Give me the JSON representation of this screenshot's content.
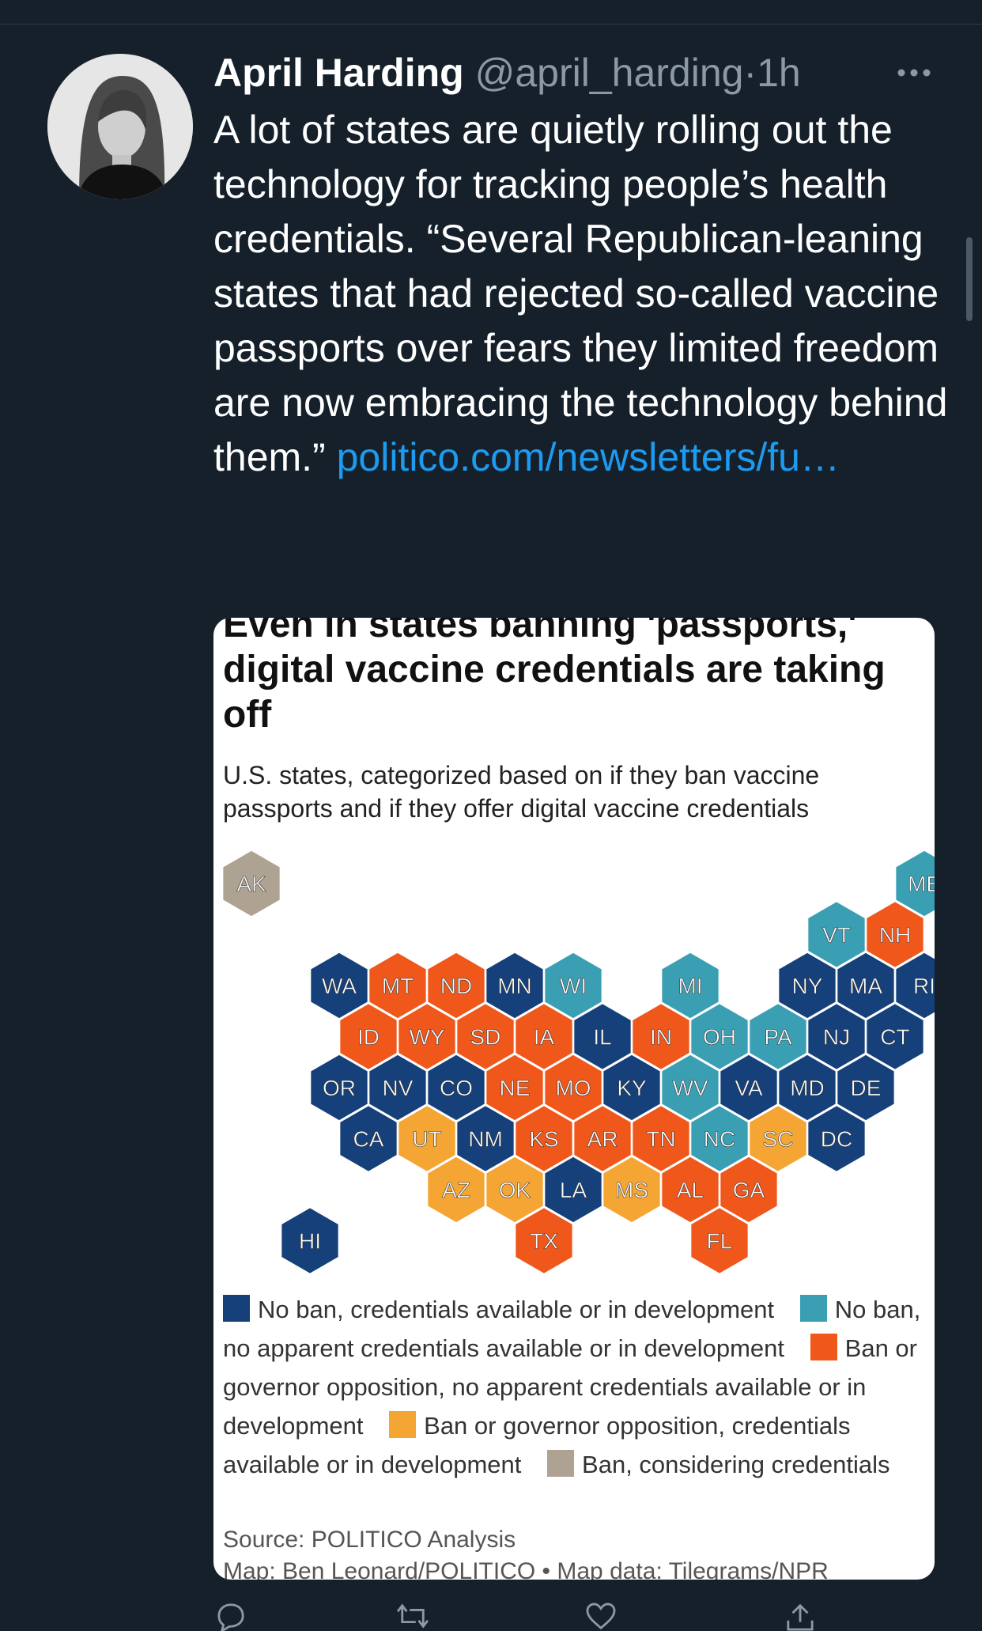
{
  "tweet": {
    "author_name": "April Harding",
    "handle": "@april_harding",
    "separator": "·",
    "time": "1h",
    "text": "A lot of states are quietly rolling out the technology for tracking people’s health credentials. “Several Republican-leaning states that had rejected so-called vaccine passports over fears they limited freedom are now embracing the technology behind them.” ",
    "link_text": "politico.com/newsletters/fu…"
  },
  "card": {
    "title": "Even in states banning 'passports,' digital vaccine credentials are taking off",
    "subtitle": "U.S. states, categorized based on if they ban vaccine passports and if they offer digital vaccine credentials",
    "source": "Source: POLITICO Analysis",
    "credit": "Map: Ben Leonard/POLITICO • Map data: Tilegrams/NPR"
  },
  "colors": {
    "background": "#15202b",
    "accent": "#1d9bf0",
    "no_ban_credentials": "#15407a",
    "no_ban_no_credentials": "#3b9fb4",
    "ban_no_credentials": "#f0571b",
    "ban_credentials": "#f5a533",
    "ban_considering": "#aea293"
  },
  "legend": [
    {
      "key": "no_ban_credentials",
      "label": "No ban, credentials available or in development"
    },
    {
      "key": "no_ban_no_credentials",
      "label": "No ban, no apparent credentials available or in development"
    },
    {
      "key": "ban_no_credentials",
      "label": "Ban or governor opposition, no apparent credentials available or in development"
    },
    {
      "key": "ban_credentials",
      "label": "Ban or governor opposition, credentials available or in development"
    },
    {
      "key": "ban_considering",
      "label": "Ban, considering credentials"
    }
  ],
  "map_states": [
    {
      "abbr": "AK",
      "category": "ban_considering",
      "row": 0,
      "col": 0
    },
    {
      "abbr": "ME",
      "category": "no_ban_no_credentials",
      "row": 0,
      "col": 11.5
    },
    {
      "abbr": "VT",
      "category": "no_ban_no_credentials",
      "row": 1,
      "col": 10
    },
    {
      "abbr": "NH",
      "category": "ban_no_credentials",
      "row": 1,
      "col": 11
    },
    {
      "abbr": "WA",
      "category": "no_ban_credentials",
      "row": 2,
      "col": 1.5
    },
    {
      "abbr": "MT",
      "category": "ban_no_credentials",
      "row": 2,
      "col": 2.5
    },
    {
      "abbr": "ND",
      "category": "ban_no_credentials",
      "row": 2,
      "col": 3.5
    },
    {
      "abbr": "MN",
      "category": "no_ban_credentials",
      "row": 2,
      "col": 4.5
    },
    {
      "abbr": "WI",
      "category": "no_ban_no_credentials",
      "row": 2,
      "col": 5.5
    },
    {
      "abbr": "MI",
      "category": "no_ban_no_credentials",
      "row": 2,
      "col": 7.5
    },
    {
      "abbr": "NY",
      "category": "no_ban_credentials",
      "row": 2,
      "col": 9.5
    },
    {
      "abbr": "MA",
      "category": "no_ban_credentials",
      "row": 2,
      "col": 10.5
    },
    {
      "abbr": "RI",
      "category": "no_ban_credentials",
      "row": 2,
      "col": 11.5
    },
    {
      "abbr": "ID",
      "category": "ban_no_credentials",
      "row": 3,
      "col": 2
    },
    {
      "abbr": "WY",
      "category": "ban_no_credentials",
      "row": 3,
      "col": 3
    },
    {
      "abbr": "SD",
      "category": "ban_no_credentials",
      "row": 3,
      "col": 4
    },
    {
      "abbr": "IA",
      "category": "ban_no_credentials",
      "row": 3,
      "col": 5
    },
    {
      "abbr": "IL",
      "category": "no_ban_credentials",
      "row": 3,
      "col": 6
    },
    {
      "abbr": "IN",
      "category": "ban_no_credentials",
      "row": 3,
      "col": 7
    },
    {
      "abbr": "OH",
      "category": "no_ban_no_credentials",
      "row": 3,
      "col": 8
    },
    {
      "abbr": "PA",
      "category": "no_ban_no_credentials",
      "row": 3,
      "col": 9
    },
    {
      "abbr": "NJ",
      "category": "no_ban_credentials",
      "row": 3,
      "col": 10
    },
    {
      "abbr": "CT",
      "category": "no_ban_credentials",
      "row": 3,
      "col": 11
    },
    {
      "abbr": "OR",
      "category": "no_ban_credentials",
      "row": 4,
      "col": 1.5
    },
    {
      "abbr": "NV",
      "category": "no_ban_credentials",
      "row": 4,
      "col": 2.5
    },
    {
      "abbr": "CO",
      "category": "no_ban_credentials",
      "row": 4,
      "col": 3.5
    },
    {
      "abbr": "NE",
      "category": "ban_no_credentials",
      "row": 4,
      "col": 4.5
    },
    {
      "abbr": "MO",
      "category": "ban_no_credentials",
      "row": 4,
      "col": 5.5
    },
    {
      "abbr": "KY",
      "category": "no_ban_credentials",
      "row": 4,
      "col": 6.5
    },
    {
      "abbr": "WV",
      "category": "no_ban_no_credentials",
      "row": 4,
      "col": 7.5
    },
    {
      "abbr": "VA",
      "category": "no_ban_credentials",
      "row": 4,
      "col": 8.5
    },
    {
      "abbr": "MD",
      "category": "no_ban_credentials",
      "row": 4,
      "col": 9.5
    },
    {
      "abbr": "DE",
      "category": "no_ban_credentials",
      "row": 4,
      "col": 10.5
    },
    {
      "abbr": "CA",
      "category": "no_ban_credentials",
      "row": 5,
      "col": 2
    },
    {
      "abbr": "UT",
      "category": "ban_credentials",
      "row": 5,
      "col": 3
    },
    {
      "abbr": "NM",
      "category": "no_ban_credentials",
      "row": 5,
      "col": 4
    },
    {
      "abbr": "KS",
      "category": "ban_no_credentials",
      "row": 5,
      "col": 5
    },
    {
      "abbr": "AR",
      "category": "ban_no_credentials",
      "row": 5,
      "col": 6
    },
    {
      "abbr": "TN",
      "category": "ban_no_credentials",
      "row": 5,
      "col": 7
    },
    {
      "abbr": "NC",
      "category": "no_ban_no_credentials",
      "row": 5,
      "col": 8
    },
    {
      "abbr": "SC",
      "category": "ban_credentials",
      "row": 5,
      "col": 9
    },
    {
      "abbr": "DC",
      "category": "no_ban_credentials",
      "row": 5,
      "col": 10
    },
    {
      "abbr": "AZ",
      "category": "ban_credentials",
      "row": 6,
      "col": 3.5
    },
    {
      "abbr": "OK",
      "category": "ban_credentials",
      "row": 6,
      "col": 4.5
    },
    {
      "abbr": "LA",
      "category": "no_ban_credentials",
      "row": 6,
      "col": 5.5
    },
    {
      "abbr": "MS",
      "category": "ban_credentials",
      "row": 6,
      "col": 6.5
    },
    {
      "abbr": "AL",
      "category": "ban_no_credentials",
      "row": 6,
      "col": 7.5
    },
    {
      "abbr": "GA",
      "category": "ban_no_credentials",
      "row": 6,
      "col": 8.5
    },
    {
      "abbr": "HI",
      "category": "no_ban_credentials",
      "row": 7,
      "col": 1
    },
    {
      "abbr": "TX",
      "category": "ban_no_credentials",
      "row": 7,
      "col": 5
    },
    {
      "abbr": "FL",
      "category": "ban_no_credentials",
      "row": 7,
      "col": 8
    }
  ],
  "actions": [
    {
      "name": "reply-icon"
    },
    {
      "name": "retweet-icon"
    },
    {
      "name": "like-icon"
    },
    {
      "name": "share-icon"
    }
  ]
}
